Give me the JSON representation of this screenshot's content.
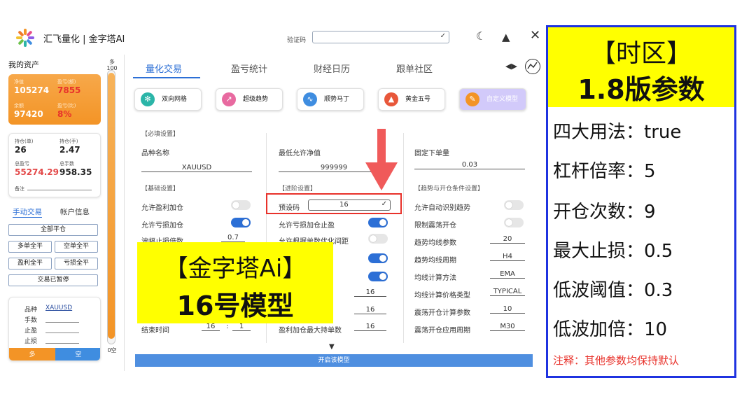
{
  "app": {
    "title": "汇飞量化 | 金字塔AI",
    "verify_label": "验证码"
  },
  "left": {
    "assets_title": "我的资产",
    "card1": {
      "net_lbl": "净值",
      "net_val": "105274",
      "pnl_usd_lbl": "盈亏(额)",
      "pnl_usd_val": "7855",
      "bal_lbl": "余额",
      "bal_val": "97420",
      "pnl_pct_lbl": "盈亏(比)",
      "pnl_pct_val": "8%"
    },
    "card2": {
      "pos_lbl": "持仓(单)",
      "pos_val": "26",
      "lots_lbl": "持仓(手)",
      "lots_val": "2.47",
      "total_pnl_lbl": "总盈亏",
      "total_pnl_val": "55274.29",
      "total_lots_lbl": "总手数",
      "total_lots_val": "958.35",
      "note_lbl": "备注"
    },
    "tabs": {
      "manual": "手动交易",
      "account": "帐户信息"
    },
    "buttons": {
      "close_all": "全部平仓",
      "close_long": "多单全平",
      "close_short": "空单全平",
      "close_profit": "盈利全平",
      "close_loss": "亏损全平",
      "paused": "交易已暂停"
    },
    "order": {
      "symbol_lbl": "品种",
      "symbol_val": "XAUUSD",
      "lots_lbl": "手数",
      "tp_lbl": "止盈",
      "sl_lbl": "止损",
      "long": "多",
      "short": "空"
    },
    "slider": {
      "top": "多100",
      "bottom": "0空"
    }
  },
  "main": {
    "tabs": [
      "量化交易",
      "盈亏统计",
      "财经日历",
      "跟单社区"
    ],
    "models": [
      "双向网格",
      "超级趋势",
      "顺势马丁",
      "黄金五号",
      "自定义模型"
    ],
    "col1": {
      "required": "【必填设置】",
      "symbol_lbl": "品种名称",
      "symbol_val": "XAUUSD",
      "basic": "【基础设置】",
      "allow_profit_add": "允许盈利加仓",
      "allow_loss_add": "允许亏损加仓",
      "loss_mult": "波幅止损倍数",
      "loss_mult_val": "0.7",
      "end_time": "结束时间",
      "end_h": "16",
      "end_m": "1"
    },
    "col2": {
      "min_equity": "最低允许净值",
      "min_equity_val": "999999",
      "advanced": "【进阶设置】",
      "preset_lbl": "预设码",
      "preset_val": "16",
      "allow_loss_stop": "允许亏损加仓止盈",
      "allow_pos_opt": "允许根据单数优化间距",
      "v1": "16",
      "v2": "16",
      "max_profit_lots": "盈利加仓最大持单数",
      "max_profit_lots_val": "16"
    },
    "col3": {
      "fixed_lot": "固定下单量",
      "fixed_lot_val": "0.03",
      "trend": "【趋势与开仓条件设置】",
      "auto_trend": "允许自动识别趋势",
      "limit_shock": "限制震荡开仓",
      "trend_ma": "趋势均线参数",
      "trend_ma_val": "20",
      "trend_period": "趋势均线周期",
      "trend_period_val": "H4",
      "ma_method": "均线计算方法",
      "ma_method_val": "EMA",
      "ma_price": "均线计算价格类型",
      "ma_price_val": "TYPICAL",
      "shock_param": "震荡开仓计算参数",
      "shock_param_val": "10",
      "shock_period": "震荡开仓应用周期",
      "shock_period_val": "M30"
    },
    "start_btn": "开启该模型"
  },
  "overlay": {
    "line1": "【金字塔Ai】",
    "line2": "16号模型"
  },
  "right": {
    "h1": "【时区】",
    "h2": "1.8版参数",
    "rows": [
      "四大用法：true",
      "杠杆倍率：5",
      "开仓次数：9",
      "最大止损：0.5",
      "低波阈值：0.3",
      "低波加倍：10"
    ],
    "note": "注释：其他参数均保持默认"
  },
  "colors": {
    "accent": "#2c6fd6",
    "orange": "#f39426",
    "highlight": "#ffff00",
    "frame": "#1f33e0",
    "alert": "#e8322b"
  }
}
